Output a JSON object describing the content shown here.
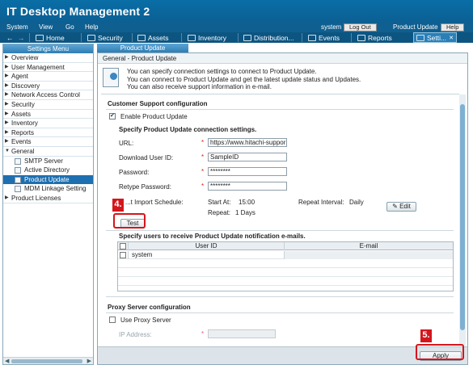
{
  "app": {
    "title": "IT Desktop Management 2"
  },
  "menu": {
    "items": [
      "System",
      "View",
      "Go",
      "Help"
    ],
    "user": "system",
    "logout": "Log Out",
    "product": "Product Update",
    "help": "Help"
  },
  "toolbar": {
    "home": "Home",
    "security": "Security",
    "assets": "Assets",
    "inventory": "Inventory",
    "distribution": "Distribution...",
    "events": "Events",
    "reports": "Reports",
    "settings": "Setti...",
    "nav_back": "←",
    "nav_forward": "→"
  },
  "sidebar": {
    "header": "Settings Menu",
    "items": [
      "Overview",
      "User Management",
      "Agent",
      "Discovery",
      "Network Access Control",
      "Security",
      "Assets",
      "Inventory",
      "Reports",
      "Events",
      "General"
    ],
    "general_children": [
      "SMTP Server",
      "Active Directory",
      "Product Update",
      "MDM Linkage Setting"
    ],
    "after": [
      "Product Licenses"
    ]
  },
  "main": {
    "tab": "Product Update",
    "breadcrumb": "General - Product Update",
    "info_lines": [
      "You can specify connection settings to connect to Product Update.",
      "You can connect to Product Update and get the latest update status and Updates.",
      "You can also receive support information in e-mail."
    ],
    "customer_support_title": "Customer Support configuration",
    "enable_label": "Enable Product Update",
    "enable_checked": true,
    "connection_title": "Specify Product Update connection settings.",
    "url_label": "URL:",
    "url_value": "https://www.hitachi-suppor",
    "download_label": "Download User ID:",
    "download_value": "SampleID",
    "password_label": "Password:",
    "password_value": "********",
    "retype_label": "Retype Password:",
    "retype_value": "********",
    "import_label": "Product Update Import Schedule:",
    "import_label_visible": "...t Import Schedule:",
    "start_at_label": "Start At:",
    "start_at_value": "15:00",
    "repeat_label": "Repeat:",
    "repeat_value": "1 Days",
    "repeat_interval_label": "Repeat Interval:",
    "repeat_interval_value": "Daily",
    "edit_button": "Edit",
    "test_button": "Test",
    "users_title": "Specify users to receive Product Update notification e-mails.",
    "grid_headers": [
      "User ID",
      "E-mail"
    ],
    "grid_rows": [
      {
        "user": "system",
        "email": ""
      }
    ],
    "proxy_title": "Proxy Server configuration",
    "proxy_label": "Use Proxy Server",
    "ip_label": "IP Address:",
    "apply_button": "Apply"
  },
  "callouts": {
    "test_badge": "4.",
    "apply_badge": "5."
  },
  "colors": {
    "brand": "#0b5f93",
    "callout": "#d4161c",
    "selected": "#1d6fb0"
  }
}
